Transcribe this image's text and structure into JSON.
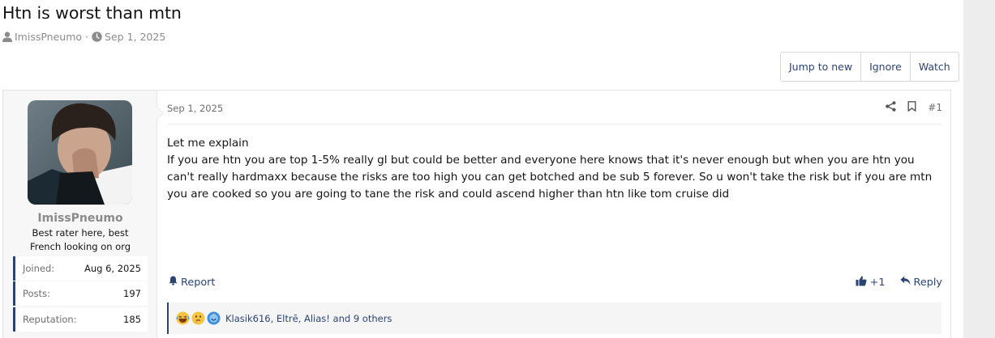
{
  "thread": {
    "title": "Htn is worst than mtn",
    "author": "ImissPneumo",
    "separator": "·",
    "date": "Sep 1, 2025"
  },
  "actions": {
    "jump_to_new": "Jump to new",
    "ignore": "Ignore",
    "watch": "Watch"
  },
  "post": {
    "date": "Sep 1, 2025",
    "number": "#1",
    "user": {
      "name": "ImissPneumo",
      "title": "Best rater here, best French looking on org",
      "stats": [
        {
          "label": "Joined:",
          "value": "Aug 6, 2025"
        },
        {
          "label": "Posts:",
          "value": "197"
        },
        {
          "label": "Reputation:",
          "value": "185"
        }
      ]
    },
    "body": {
      "line1": "Let me explain",
      "line2": "If you are htn you are top 1-5% really gl but could be better and everyone here knows that it's never enough but when you are htn you can't really hardmaxx because the risks are too high you can get botched and be sub 5 forever. So u won't take the risk but if you are mtn you are cooked so you are going to tane the risk and could ascend higher than htn like tom cruise did"
    },
    "footer": {
      "report": "Report",
      "reaction_count": "+1",
      "reply": "Reply"
    },
    "reactions": {
      "text": "Klasik616, Eltrē, Alias! and 9 others"
    }
  },
  "colors": {
    "link": "#2b4470",
    "muted": "#8c8c8c",
    "panel": "#f7f7f7"
  },
  "icons": [
    "user-icon",
    "clock-icon",
    "share-icon",
    "bookmark-icon",
    "bell-icon",
    "thumbs-up-icon",
    "reply-icon",
    "laughing-emoji-icon",
    "thinking-emoji-icon",
    "blue-emoji-icon"
  ]
}
